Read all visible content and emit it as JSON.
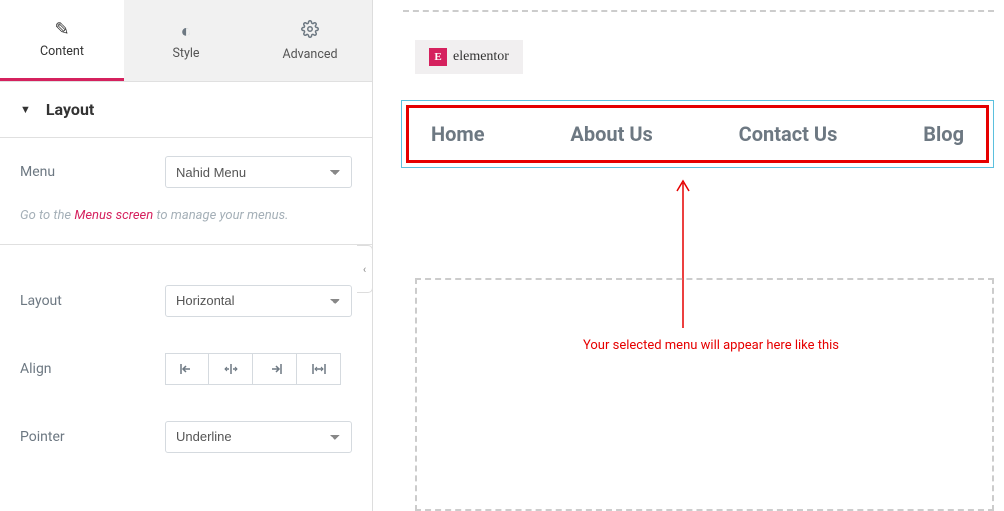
{
  "tabs": {
    "content": "Content",
    "style": "Style",
    "advanced": "Advanced"
  },
  "section": {
    "layout": "Layout"
  },
  "controls": {
    "menu": {
      "label": "Menu",
      "value": "Nahid Menu"
    },
    "layout": {
      "label": "Layout",
      "value": "Horizontal"
    },
    "align": {
      "label": "Align"
    },
    "pointer": {
      "label": "Pointer",
      "value": "Underline"
    }
  },
  "hint": {
    "prefix": "Go to the ",
    "link": "Menus screen",
    "suffix": " to manage your menus."
  },
  "preview": {
    "badge": "elementor",
    "menu_items": [
      "Home",
      "About Us",
      "Contact Us",
      "Blog"
    ],
    "annotation": "Your selected menu will appear here like this"
  }
}
